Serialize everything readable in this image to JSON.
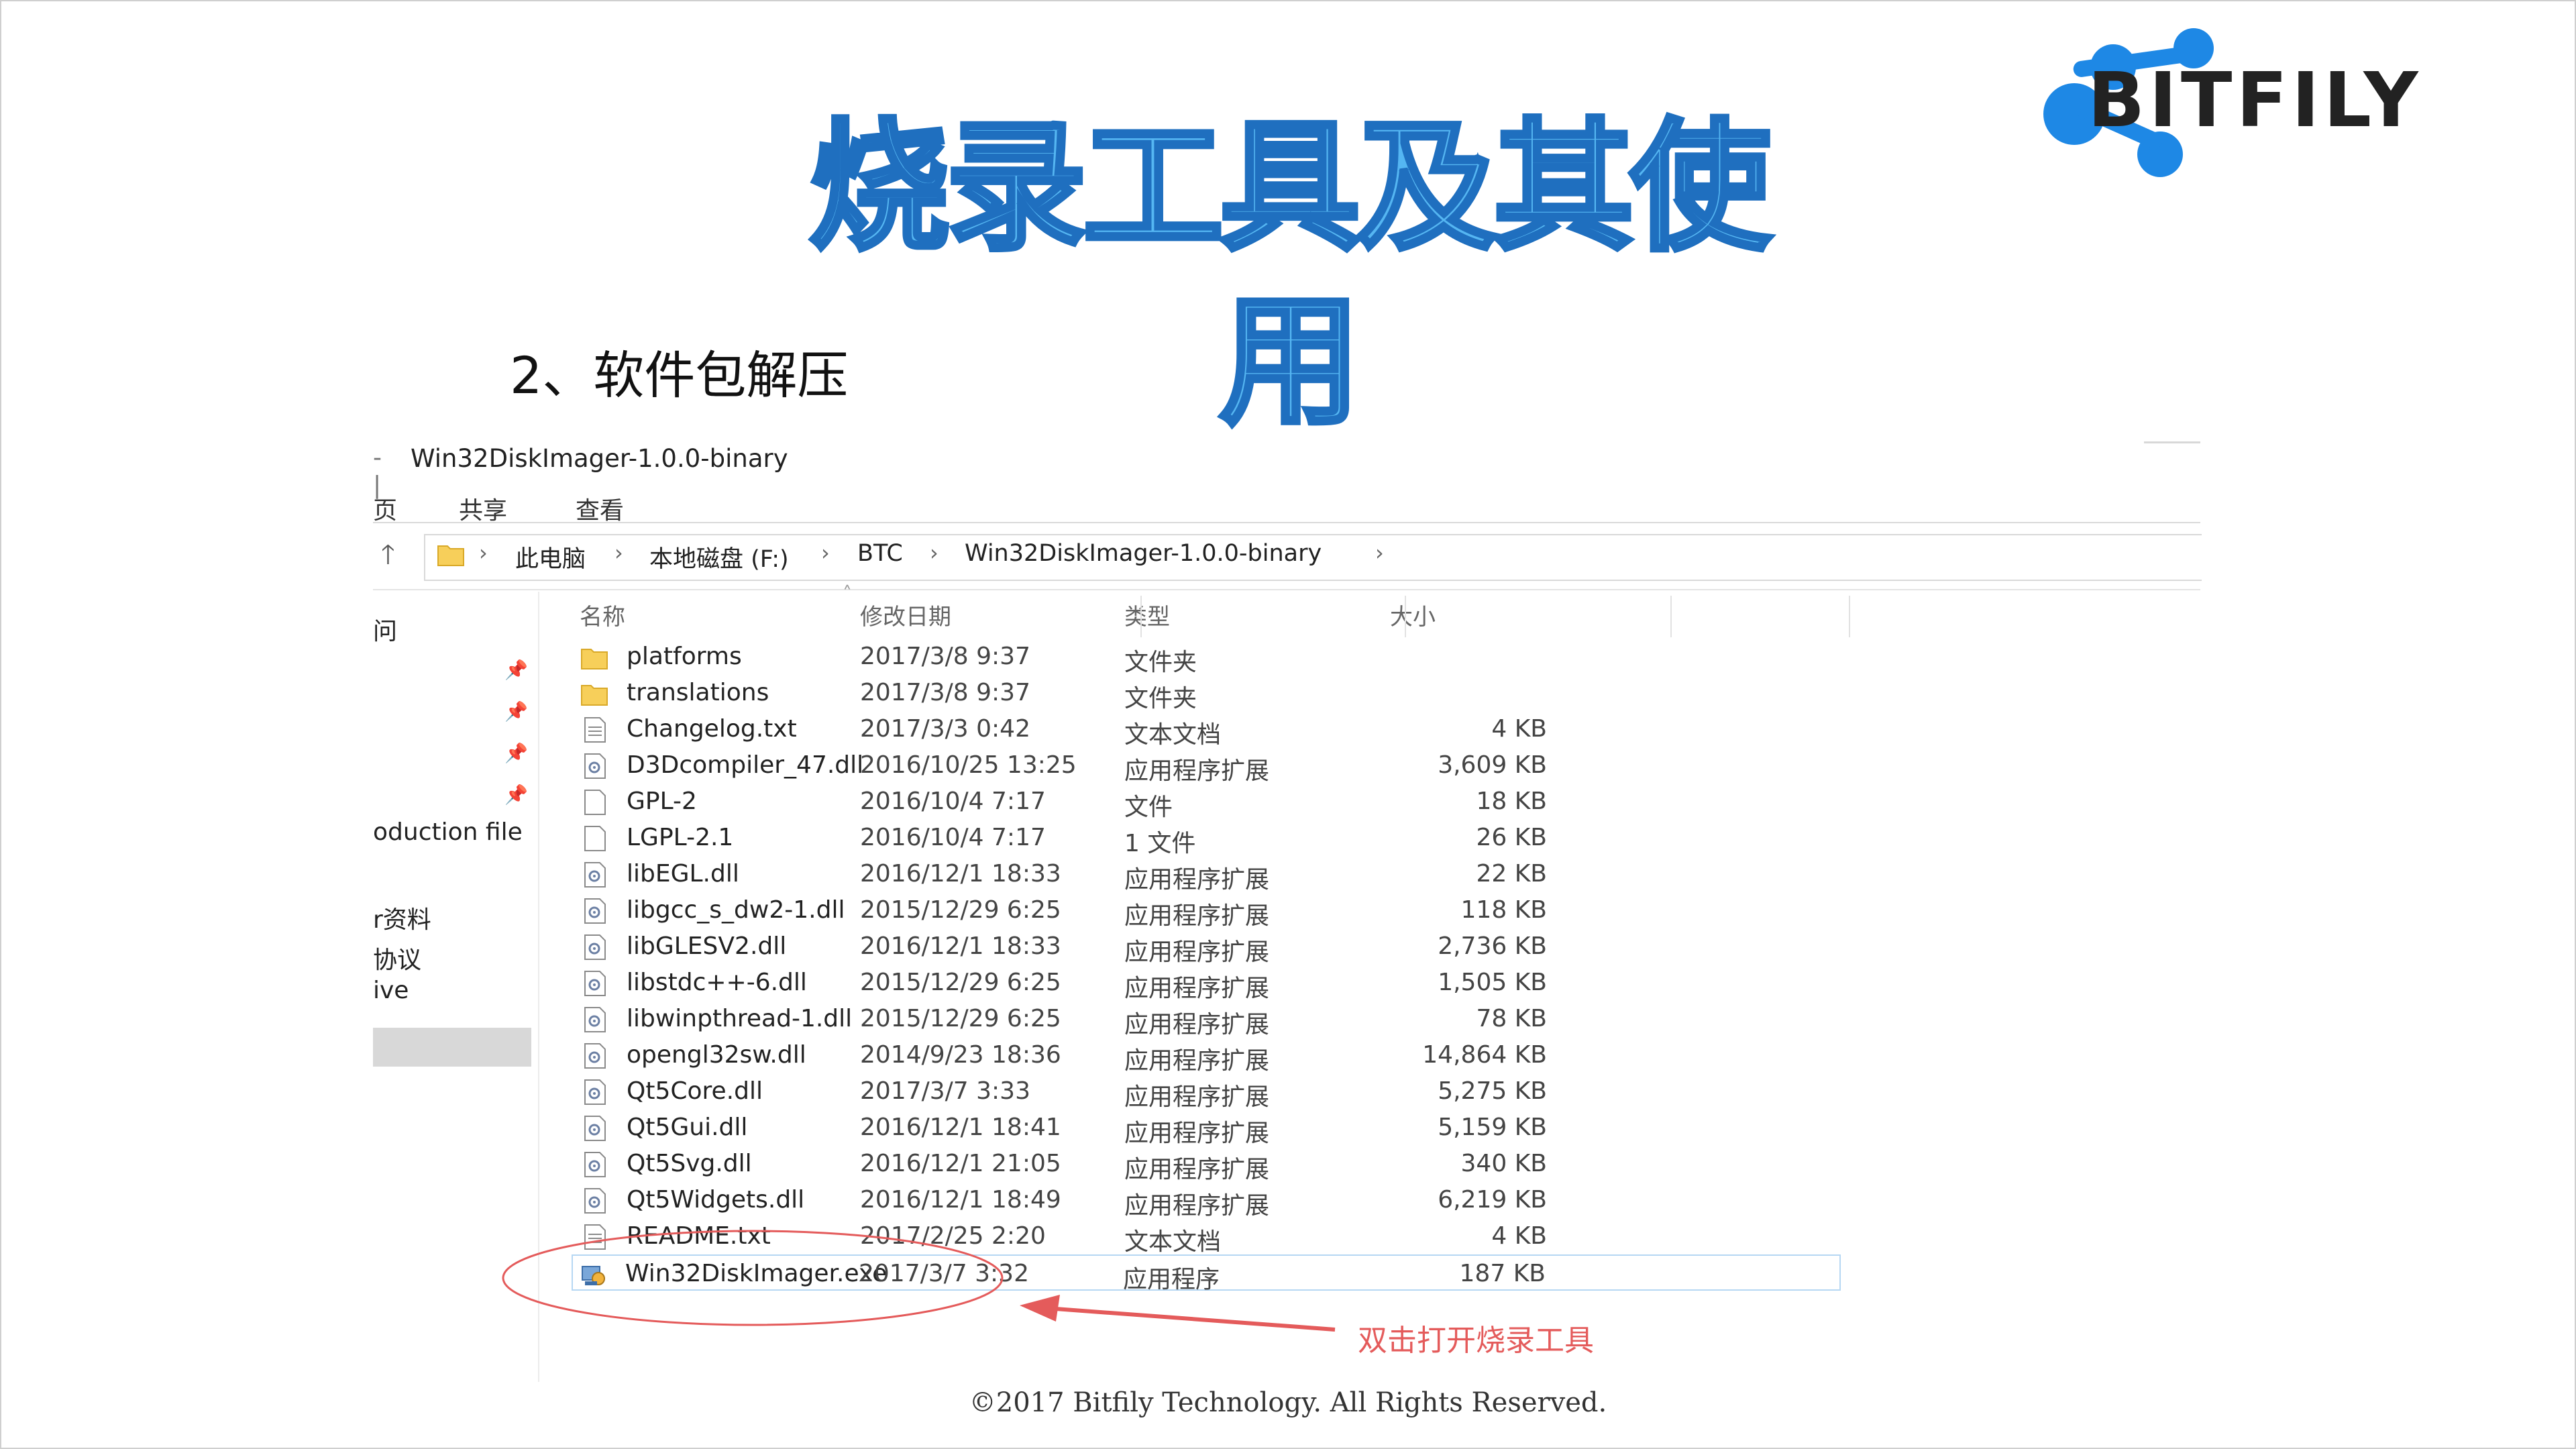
{
  "slide": {
    "title": "烧录工具及其使用",
    "step": "2、软件包解压",
    "footer": "©2017 Bitfily Technology. All Rights Reserved.",
    "annotation": "双击打开烧录工具",
    "logo_text": "BITFILY",
    "colors": {
      "title_fill": "#55b6f2",
      "title_stroke": "#1f6fbf",
      "logo_blue": "#1e88e5",
      "annotation_red": "#e45b5b"
    }
  },
  "explorer": {
    "window_title": "Win32DiskImager-1.0.0-binary",
    "title_sep": "- |",
    "ribbon_tabs": [
      "页",
      "共享",
      "查看"
    ],
    "breadcrumbs": [
      "此电脑",
      "本地磁盘 (F:)",
      "BTC",
      "Win32DiskImager-1.0.0-binary"
    ],
    "nav_items": [
      "问",
      "oduction file",
      "r资料",
      "协议",
      "ive"
    ],
    "columns": {
      "name": "名称",
      "modified": "修改日期",
      "type": "类型",
      "size": "大小"
    },
    "files": [
      {
        "name": "platforms",
        "modified": "2017/3/8 9:37",
        "type": "文件夹",
        "size": "",
        "icon": "folder-icon"
      },
      {
        "name": "translations",
        "modified": "2017/3/8 9:37",
        "type": "文件夹",
        "size": "",
        "icon": "folder-icon"
      },
      {
        "name": "Changelog.txt",
        "modified": "2017/3/3 0:42",
        "type": "文本文档",
        "size": "4 KB",
        "icon": "text-file-icon"
      },
      {
        "name": "D3Dcompiler_47.dll",
        "modified": "2016/10/25 13:25",
        "type": "应用程序扩展",
        "size": "3,609 KB",
        "icon": "dll-file-icon"
      },
      {
        "name": "GPL-2",
        "modified": "2016/10/4 7:17",
        "type": "文件",
        "size": "18 KB",
        "icon": "blank-file-icon"
      },
      {
        "name": "LGPL-2.1",
        "modified": "2016/10/4 7:17",
        "type": "1 文件",
        "size": "26 KB",
        "icon": "blank-file-icon"
      },
      {
        "name": "libEGL.dll",
        "modified": "2016/12/1 18:33",
        "type": "应用程序扩展",
        "size": "22 KB",
        "icon": "dll-file-icon"
      },
      {
        "name": "libgcc_s_dw2-1.dll",
        "modified": "2015/12/29 6:25",
        "type": "应用程序扩展",
        "size": "118 KB",
        "icon": "dll-file-icon"
      },
      {
        "name": "libGLESV2.dll",
        "modified": "2016/12/1 18:33",
        "type": "应用程序扩展",
        "size": "2,736 KB",
        "icon": "dll-file-icon"
      },
      {
        "name": "libstdc++-6.dll",
        "modified": "2015/12/29 6:25",
        "type": "应用程序扩展",
        "size": "1,505 KB",
        "icon": "dll-file-icon"
      },
      {
        "name": "libwinpthread-1.dll",
        "modified": "2015/12/29 6:25",
        "type": "应用程序扩展",
        "size": "78 KB",
        "icon": "dll-file-icon"
      },
      {
        "name": "opengl32sw.dll",
        "modified": "2014/9/23 18:36",
        "type": "应用程序扩展",
        "size": "14,864 KB",
        "icon": "dll-file-icon"
      },
      {
        "name": "Qt5Core.dll",
        "modified": "2017/3/7 3:33",
        "type": "应用程序扩展",
        "size": "5,275 KB",
        "icon": "dll-file-icon"
      },
      {
        "name": "Qt5Gui.dll",
        "modified": "2016/12/1 18:41",
        "type": "应用程序扩展",
        "size": "5,159 KB",
        "icon": "dll-file-icon"
      },
      {
        "name": "Qt5Svg.dll",
        "modified": "2016/12/1 21:05",
        "type": "应用程序扩展",
        "size": "340 KB",
        "icon": "dll-file-icon"
      },
      {
        "name": "Qt5Widgets.dll",
        "modified": "2016/12/1 18:49",
        "type": "应用程序扩展",
        "size": "6,219 KB",
        "icon": "dll-file-icon"
      },
      {
        "name": "README.txt",
        "modified": "2017/2/25 2:20",
        "type": "文本文档",
        "size": "4 KB",
        "icon": "text-file-icon"
      },
      {
        "name": "Win32DiskImager.exe",
        "modified": "2017/3/7 3:32",
        "type": "应用程序",
        "size": "187 KB",
        "icon": "exe-app-icon",
        "highlighted": true
      }
    ]
  }
}
